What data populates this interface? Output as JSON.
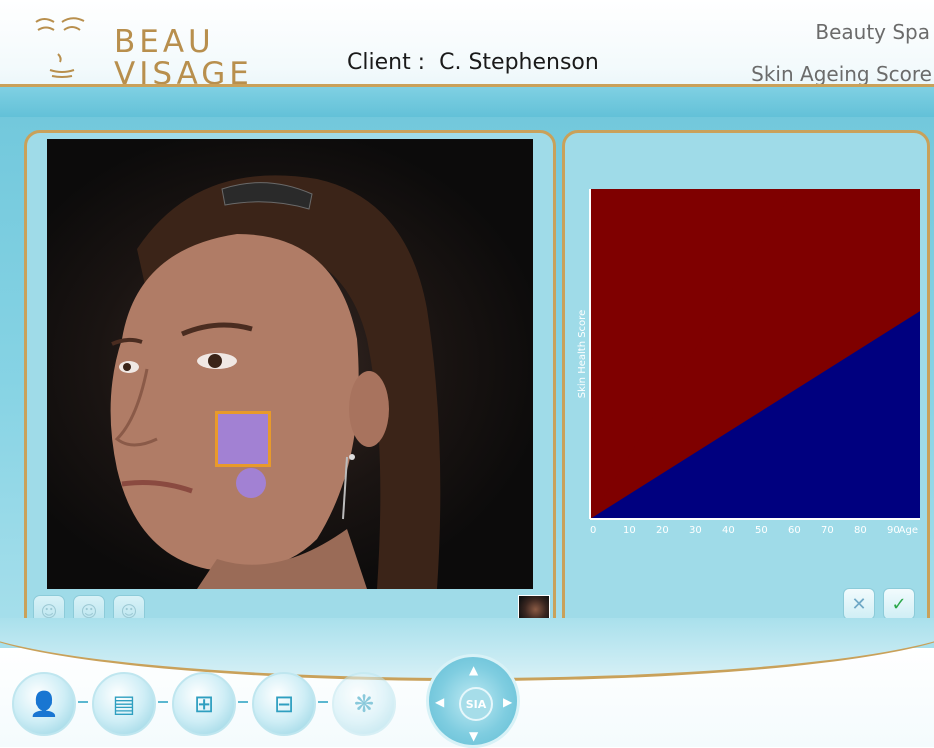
{
  "header": {
    "logo_line1": "BEAU",
    "logo_line2": "VISAGE",
    "client_label": "Client :",
    "client_name": "C. Stephenson",
    "spa_name": "Beauty Spa",
    "screen_title": "Skin Ageing Score"
  },
  "left_panel": {
    "tools": [
      {
        "icon": "face-front-icon"
      },
      {
        "icon": "face-mask-icon"
      },
      {
        "icon": "face-side-icon"
      }
    ],
    "thumbnail_icon": "portrait-thumbnail-icon"
  },
  "chart_data": {
    "type": "heatmap",
    "title": "",
    "xlabel": "Age",
    "ylabel": "Skin Health Score",
    "x_ticks": [
      "0",
      "10",
      "20",
      "30",
      "40",
      "50",
      "60",
      "70",
      "80",
      "90"
    ],
    "xlim": [
      0,
      100
    ],
    "colors": {
      "upper": "#7f0000",
      "lower": "#00007f"
    },
    "gradient": [
      "#7f0000",
      "#ff0000",
      "#ff8800",
      "#ffff00",
      "#00ffff",
      "#0080ff",
      "#0000ff",
      "#00007f"
    ]
  },
  "actions": {
    "cancel_icon": "close-x-icon",
    "confirm_icon": "checkmark-icon"
  },
  "nav": {
    "items": [
      "client-icon",
      "document-icon",
      "workflow-forward-icon",
      "workflow-table-icon",
      "pattern-icon"
    ],
    "sia_label": "SIA"
  },
  "colors": {
    "accent_gold": "#c9a15a",
    "panel_blue": "#9fdbe8",
    "band_blue": "#72c8dc"
  }
}
